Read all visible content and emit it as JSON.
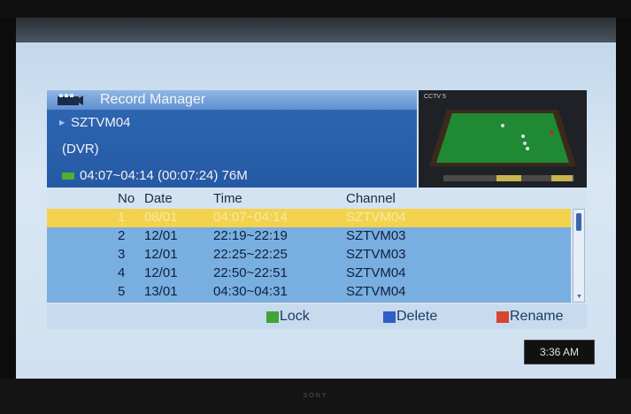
{
  "header": {
    "title": "Record Manager",
    "icon": "film-camera-icon"
  },
  "recording_info": {
    "channel": "SZTVM04",
    "source": "(DVR)",
    "time_range": "04:07~04:14 (00:07:24) 76M"
  },
  "preview": {
    "channel_logo": "CCTV 5"
  },
  "table": {
    "columns": [
      "No",
      "Date",
      "Time",
      "Channel"
    ],
    "rows": [
      {
        "no": "1",
        "date": "08/01",
        "time": "04:07~04:14",
        "channel": "SZTVM04",
        "selected": true
      },
      {
        "no": "2",
        "date": "12/01",
        "time": "22:19~22:19",
        "channel": "SZTVM03"
      },
      {
        "no": "3",
        "date": "12/01",
        "time": "22:25~22:25",
        "channel": "SZTVM03"
      },
      {
        "no": "4",
        "date": "12/01",
        "time": "22:50~22:51",
        "channel": "SZTVM04"
      },
      {
        "no": "5",
        "date": "13/01",
        "time": "04:30~04:31",
        "channel": "SZTVM04"
      }
    ]
  },
  "buttons": {
    "lock": {
      "label": "Lock",
      "color": "#3fa535"
    },
    "delete": {
      "label": "Delete",
      "color": "#2f5fc4"
    },
    "rename": {
      "label": "Rename",
      "color": "#d9452e"
    }
  },
  "clock": "3:36 AM",
  "tv_brand": "SONY",
  "colors": {
    "selected_row": "#f3d24d",
    "row": "#79afe0",
    "panel": "#2a5fab"
  }
}
